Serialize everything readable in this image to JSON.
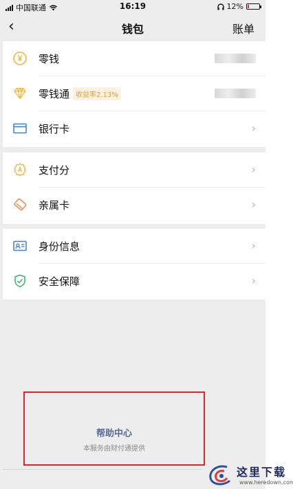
{
  "status_bar": {
    "carrier": "中国联通",
    "time": "16:19",
    "battery": "12%",
    "battery_level": 0.12
  },
  "nav": {
    "back_icon": "chevron-left-icon",
    "title": "钱包",
    "right_action": "账单"
  },
  "group1": {
    "change": {
      "label": "零钱",
      "icon": "yen-coin-icon",
      "value_blurred": true
    },
    "lingqiantong": {
      "label": "零钱通",
      "badge": "收益率2.13%",
      "icon": "diamond-icon",
      "value_blurred": true
    },
    "bank_card": {
      "label": "银行卡",
      "icon": "bank-card-icon"
    }
  },
  "group2": {
    "pay_score": {
      "label": "支付分",
      "icon": "score-shield-icon"
    },
    "family_card": {
      "label": "亲属卡",
      "icon": "family-card-icon"
    }
  },
  "group3": {
    "identity": {
      "label": "身份信息",
      "icon": "id-card-icon"
    },
    "security": {
      "label": "安全保障",
      "icon": "shield-check-icon"
    }
  },
  "help": {
    "title": "帮助中心",
    "subtitle": "本服务由财付通提供"
  },
  "watermark": {
    "cn": "这里下载",
    "en": "www.heredown.com"
  },
  "colors": {
    "accent_gold": "#f0b63a",
    "badge_text": "#d9a441",
    "blue_icon": "#3e7fce",
    "green_icon": "#3aaf6b",
    "orange_icon": "#f08a4b",
    "help_link": "#566b94",
    "highlight_border": "#e0242a"
  }
}
